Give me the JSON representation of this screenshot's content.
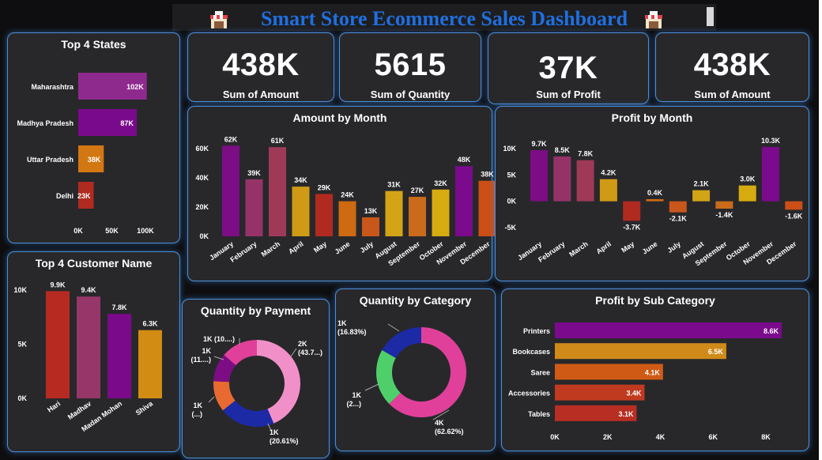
{
  "header": {
    "title": "Smart Store Ecommerce  Sales Dashboard",
    "icons": [
      "shop-icon",
      "shop-icon"
    ]
  },
  "kpis": [
    {
      "value": "438K",
      "label": "Sum of Amount"
    },
    {
      "value": "5615",
      "label": "Sum of Quantity"
    },
    {
      "value": "37K",
      "label": "Sum of Profit"
    },
    {
      "value": "438K",
      "label": "Sum of Amount"
    }
  ],
  "chart_data": [
    {
      "id": "top-states",
      "type": "bar",
      "orientation": "horizontal",
      "title": "Top 4 States",
      "categories": [
        "Maharashtra",
        "Madhya Pradesh",
        "Uttar Pradesh",
        "Delhi"
      ],
      "values": [
        102,
        87,
        38,
        23
      ],
      "data_labels": [
        "102K",
        "87K",
        "38K",
        "23K"
      ],
      "xlim": [
        0,
        100
      ],
      "ticks": [
        0,
        50,
        100
      ],
      "tick_labels": [
        "0K",
        "50K",
        "100K"
      ],
      "colors": [
        "#8e2a8e",
        "#7a0a8c",
        "#d37712",
        "#b02a20"
      ]
    },
    {
      "id": "top-customers",
      "type": "bar",
      "title": "Top 4 Customer Name",
      "categories": [
        "Hari",
        "Madhav",
        "Madan Mohan",
        "Shiva"
      ],
      "values": [
        9.9,
        9.4,
        7.8,
        6.3
      ],
      "data_labels": [
        "9.9K",
        "9.4K",
        "7.8K",
        "6.3K"
      ],
      "ylim": [
        0,
        10
      ],
      "ticks": [
        0,
        5,
        10
      ],
      "tick_labels": [
        "0K",
        "5K",
        "10K"
      ],
      "colors": [
        "#b72a22",
        "#973669",
        "#7b0a8a",
        "#d38c13"
      ]
    },
    {
      "id": "amount-month",
      "type": "bar",
      "title": "Amount by Month",
      "categories": [
        "January",
        "February",
        "March",
        "April",
        "May",
        "June",
        "July",
        "August",
        "September",
        "October",
        "November",
        "December"
      ],
      "values": [
        62,
        39,
        61,
        34,
        29,
        24,
        13,
        31,
        27,
        32,
        48,
        38
      ],
      "data_labels": [
        "62K",
        "39K",
        "61K",
        "34K",
        "29K",
        "24K",
        "13K",
        "31K",
        "27K",
        "32K",
        "48K",
        "38K"
      ],
      "ylim": [
        0,
        60
      ],
      "ticks": [
        0,
        20,
        40,
        60
      ],
      "tick_labels": [
        "0K",
        "20K",
        "40K",
        "60K"
      ],
      "colors": [
        "#7c0d84",
        "#953369",
        "#9e3a58",
        "#cf9a15",
        "#b02a20",
        "#cd6a12",
        "#c9561a",
        "#d3a415",
        "#c96b1a",
        "#d6ab10",
        "#7b0a8c",
        "#cb4f16"
      ]
    },
    {
      "id": "profit-month",
      "type": "bar",
      "title": "Profit by Month",
      "categories": [
        "January",
        "February",
        "March",
        "April",
        "May",
        "June",
        "July",
        "August",
        "September",
        "October",
        "November",
        "December"
      ],
      "values": [
        9.7,
        8.5,
        7.8,
        4.2,
        -3.7,
        0.4,
        -2.1,
        2.1,
        -1.4,
        3.0,
        10.3,
        -1.6
      ],
      "data_labels": [
        "9.7K",
        "8.5K",
        "7.8K",
        "4.2K",
        "-3.7K",
        "0.4K",
        "-2.1K",
        "2.1K",
        "-1.4K",
        "3.0K",
        "10.3K",
        "-1.6K"
      ],
      "ylim": [
        -5,
        10
      ],
      "ticks": [
        -5,
        0,
        5,
        10
      ],
      "tick_labels": [
        "-5K",
        "0K",
        "5K",
        "10K"
      ],
      "colors": [
        "#7c0d84",
        "#953369",
        "#9e3a58",
        "#cf9a15",
        "#b02a20",
        "#cd6a12",
        "#c9561a",
        "#d3a415",
        "#c96b1a",
        "#d6ab10",
        "#7b0a8c",
        "#cb4f16"
      ]
    },
    {
      "id": "qty-payment",
      "type": "pie",
      "donut": true,
      "title": "Quantity by Payment",
      "values": [
        43.7,
        20.61,
        11.5,
        10.5,
        13.69
      ],
      "labels": [
        "2K\n(43.7...)",
        "1K\n(20.61%)",
        "1K\n(...)",
        "1K\n(11....)",
        "1K (10....)"
      ],
      "colors": [
        "#f190c8",
        "#1c2aa6",
        "#e86a30",
        "#7c0d84",
        "#e0409a"
      ]
    },
    {
      "id": "qty-category",
      "type": "pie",
      "donut": true,
      "title": "Quantity by Category",
      "values": [
        62.62,
        20.55,
        16.83
      ],
      "labels": [
        "4K\n(62.62%)",
        "1K\n(2...)",
        "1K\n(16.83%)"
      ],
      "colors": [
        "#e0409a",
        "#4fcf6a",
        "#1c2aa6"
      ]
    },
    {
      "id": "profit-subcategory",
      "type": "bar",
      "orientation": "horizontal",
      "title": "Profit by Sub Category",
      "categories": [
        "Printers",
        "Bookcases",
        "Saree",
        "Accessories",
        "Tables"
      ],
      "values": [
        8.6,
        6.5,
        4.1,
        3.4,
        3.1
      ],
      "data_labels": [
        "8.6K",
        "6.5K",
        "4.1K",
        "3.4K",
        "3.1K"
      ],
      "xlim": [
        0,
        8
      ],
      "ticks": [
        0,
        2,
        4,
        6,
        8
      ],
      "tick_labels": [
        "0K",
        "2K",
        "4K",
        "6K",
        "8K"
      ],
      "colors": [
        "#7b0a8c",
        "#cf8a1a",
        "#cf5a16",
        "#c03a20",
        "#b92e22"
      ]
    }
  ]
}
